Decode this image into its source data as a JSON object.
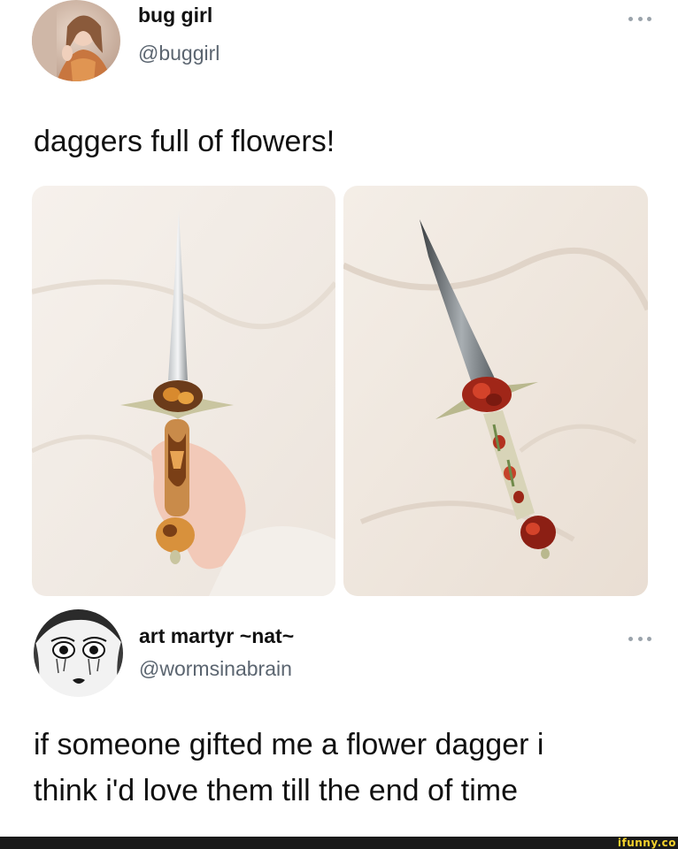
{
  "post1": {
    "display_name": "bug girl",
    "handle": "@buggirl",
    "text": "daggers full of flowers!",
    "avatar_icon": "profile-photo",
    "more_icon": "ellipsis-icon"
  },
  "post2": {
    "display_name": "art martyr ~nat~",
    "handle": "@wormsinabrain",
    "text_lines": [
      "if someone gifted me a flower dagger i",
      "think i'd love them till the end of time"
    ],
    "avatar_icon": "illustrated-face-avatar",
    "more_icon": "ellipsis-icon"
  },
  "watermark": "ifunny.co",
  "colors": {
    "handle": "#5b6570",
    "text": "#111111",
    "watermark": "#f4d22c",
    "footer": "#1a1a1a"
  }
}
